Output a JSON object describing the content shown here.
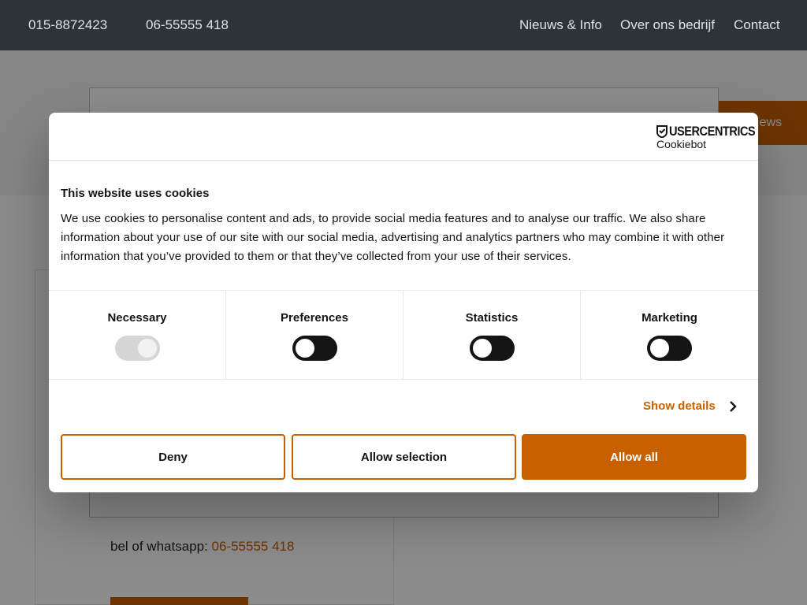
{
  "topbar": {
    "phone_1": "015-8872423",
    "phone_2": "06-55555 418",
    "nav": [
      "Nieuws & Info",
      "Over ons bedrijf",
      "Contact"
    ]
  },
  "page": {
    "news_tab_label": "ews",
    "call_label": "bel of whatsapp: ",
    "call_number": "06-55555 418"
  },
  "cookie_dialog": {
    "logo_brand": "USERCENTRICS",
    "logo_sub": "Cookiebot",
    "title": "This website uses cookies",
    "body": "We use cookies to personalise content and ads, to provide social media features and to analyse our traffic. We also share information about your use of our site with our social media, advertising and analytics partners who may combine it with other information that you’ve provided to them or that they’ve collected from your use of their services.",
    "categories": [
      {
        "label": "Necessary",
        "state": "on-disabled"
      },
      {
        "label": "Preferences",
        "state": "off"
      },
      {
        "label": "Statistics",
        "state": "off"
      },
      {
        "label": "Marketing",
        "state": "off"
      }
    ],
    "show_details": "Show details",
    "buttons": {
      "deny": "Deny",
      "allow_selection": "Allow selection",
      "allow_all": "Allow all"
    }
  },
  "colors": {
    "accent": "#c86000",
    "topbar": "#2c3437",
    "text": "#141414"
  }
}
